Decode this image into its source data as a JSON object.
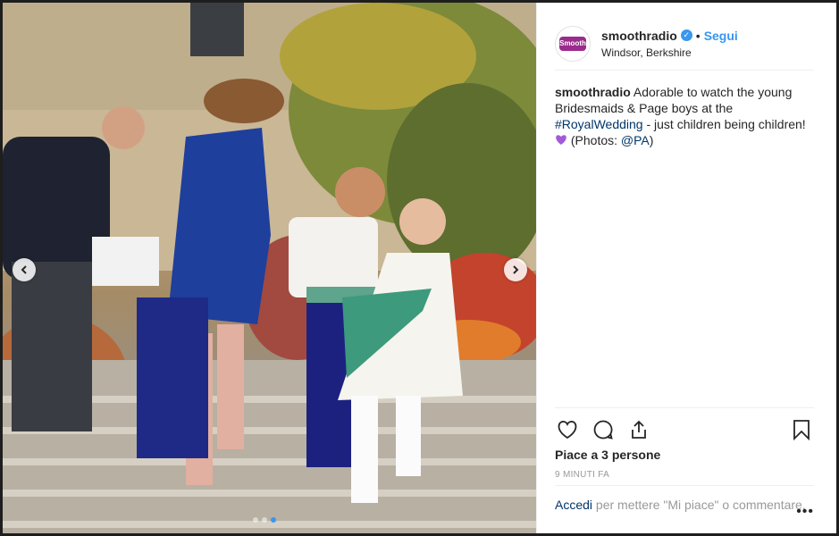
{
  "post": {
    "username": "smoothradio",
    "verified_badge": "verified-icon",
    "separator": "•",
    "follow_label": "Segui",
    "location": "Windsor, Berkshire",
    "avatar_text": "Smooth",
    "caption": {
      "username": "smoothradio",
      "text_1": " Adorable to watch the young Bridesmaids & Page boys at the ",
      "hashtag": "#RoyalWedding",
      "text_2": " - just children being children! ",
      "emoji": "purple-heart",
      "text_3": " (Photos: ",
      "mention": "@PA",
      "text_4": ")"
    },
    "likes_label": "Piace a 3 persone",
    "timestamp": "9 MINUTI FA",
    "login": {
      "link": "Accedi",
      "rest": " per mettere \"Mi piace\" o commentare."
    },
    "more_label": "•••"
  },
  "media": {
    "carousel_count": 3,
    "active_index": 2
  },
  "colors": {
    "accent": "#3897f0",
    "link": "#003569",
    "brand": "#9b2b8c"
  }
}
